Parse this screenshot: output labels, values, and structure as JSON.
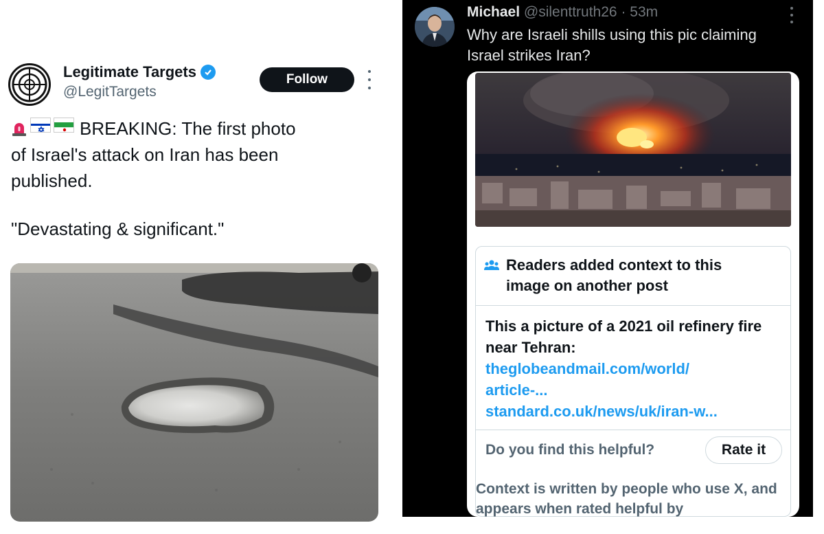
{
  "left_tweet": {
    "display_name": "Legitimate Targets",
    "handle": "@LegitTargets",
    "follow_label": "Follow",
    "text_lines": [
      "BREAKING: The first photo",
      "of Israel's attack on Iran has been",
      "published."
    ],
    "quote": "\"Devastating & significant.\"",
    "icons": [
      "crosshair-logo-icon",
      "verified-badge-icon",
      "siren-icon",
      "israel-flag-icon",
      "iran-flag-icon",
      "more-options-icon"
    ]
  },
  "right_tweet": {
    "display_name": "Michael",
    "handle": "@silenttruth26",
    "separator": " · ",
    "time": "53m",
    "text": "Why are Israeli shills using this pic claiming Israel strikes Iran?",
    "community_note": {
      "header": "Readers added context to this image on another post",
      "body": "This a picture of a 2021 oil refinery fire near Tehran:",
      "links": [
        "theglobeandmail.com/world/",
        "article-...",
        "standard.co.uk/news/uk/iran-w..."
      ],
      "helpful_question": "Do you find this helpful?",
      "rate_label": "Rate it",
      "footer": "Context is written by people who use X, and appears when rated helpful by"
    }
  },
  "colors": {
    "link_blue": "#1d9bf0",
    "dark_bg": "#000000",
    "text_dark": "#0f1419",
    "text_gray": "#536471"
  }
}
